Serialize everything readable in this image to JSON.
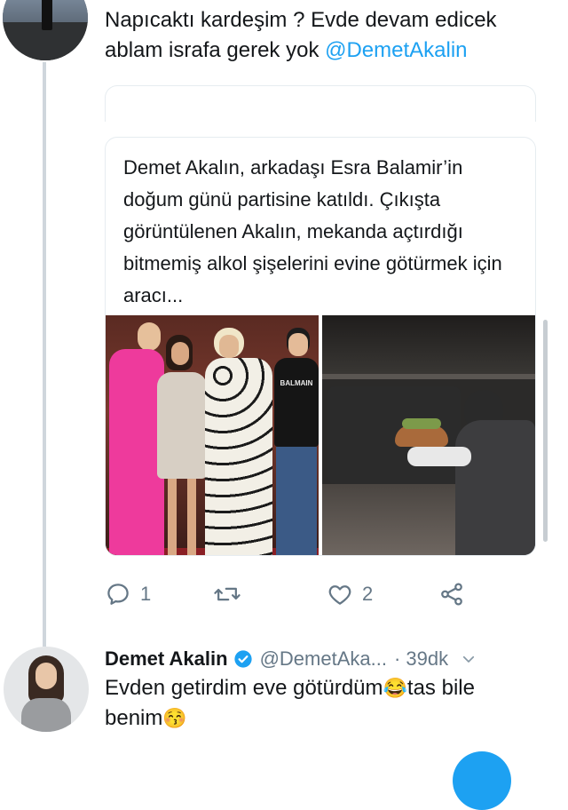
{
  "tweet": {
    "text": "Napıcaktı kardeşim ? Evde devam edicek ablam israfa gerek yok ",
    "mention": "@DemetAkalin"
  },
  "quoted": {
    "text": "Demet Akalın, arkadaşı Esra Balamir’in doğum günü partisine katıldı. Çıkışta görüntülenen Akalın, mekanda açtırdığı bitmemiş alkol şişelerini evine götürmek için aracı...",
    "shirt_text": "BALMAIN"
  },
  "actions": {
    "reply_count": "1",
    "retweet_count": "",
    "like_count": "2"
  },
  "reply": {
    "name": "Demet Akalin",
    "handle": "@DemetAka...",
    "time": "· 39dk",
    "text_part1": "Evden getirdim eve götürdüm",
    "emoji1": "😂",
    "text_part2": "tas bile benim",
    "emoji2": "😚"
  },
  "colors": {
    "accent": "#1da1f2",
    "secondary_text": "#657786",
    "thread_line": "#cfd6dc"
  },
  "icons": [
    "reply-icon",
    "retweet-icon",
    "heart-icon",
    "share-icon",
    "verified-icon",
    "chevron-down-icon"
  ]
}
